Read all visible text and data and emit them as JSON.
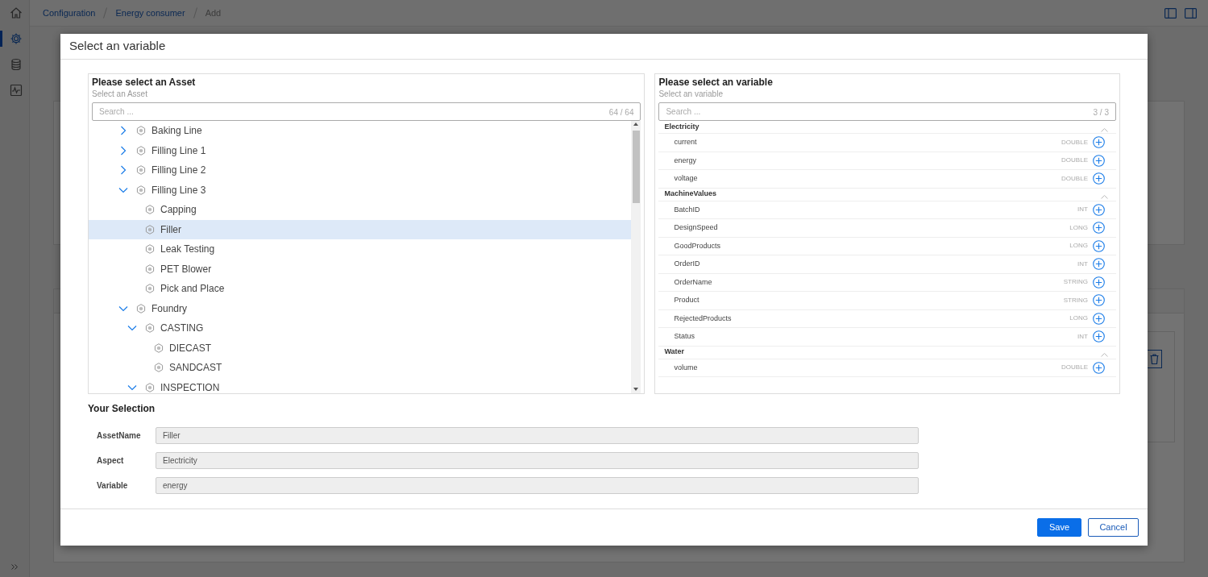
{
  "breadcrumb": [
    {
      "label": "Configuration",
      "current": false
    },
    {
      "label": "Energy consumer",
      "current": false
    },
    {
      "label": "Add",
      "current": true
    }
  ],
  "sidebar": {
    "items": [
      {
        "kind": "settings",
        "selected": true
      },
      {
        "kind": "database",
        "selected": false
      },
      {
        "kind": "monitor",
        "selected": false
      }
    ]
  },
  "dialog": {
    "title": "Select an variable",
    "asset_panel": {
      "title": "Please select an Asset",
      "subtitle": "Select an Asset",
      "search": {
        "placeholder": "Search ...",
        "count": "64 / 64"
      },
      "tree": [
        {
          "label": "Baking Line",
          "expanded": false,
          "selected": false
        },
        {
          "label": "Filling Line 1",
          "expanded": false,
          "selected": false
        },
        {
          "label": "Filling Line 2",
          "expanded": false,
          "selected": false
        },
        {
          "label": "Filling Line 3",
          "expanded": true,
          "selected": false,
          "children": [
            {
              "label": "Capping",
              "selected": false
            },
            {
              "label": "Filler",
              "selected": true
            },
            {
              "label": "Leak Testing",
              "selected": false
            },
            {
              "label": "PET Blower",
              "selected": false
            },
            {
              "label": "Pick and Place",
              "selected": false
            }
          ]
        },
        {
          "label": "Foundry",
          "expanded": true,
          "selected": false,
          "children": [
            {
              "label": "CASTING",
              "expanded": true,
              "selected": false,
              "children": [
                {
                  "label": "DIECAST",
                  "selected": false
                },
                {
                  "label": "SANDCAST",
                  "selected": false
                }
              ]
            },
            {
              "label": "INSPECTION",
              "expanded": true,
              "selected": false
            }
          ]
        }
      ]
    },
    "variable_panel": {
      "title": "Please select an variable",
      "subtitle": "Select an variable",
      "search": {
        "placeholder": "Search ...",
        "count": "3 / 3"
      },
      "groups": [
        {
          "name": "Electricity",
          "expanded": true,
          "variables": [
            {
              "name": "current",
              "type": "DOUBLE"
            },
            {
              "name": "energy",
              "type": "DOUBLE"
            },
            {
              "name": "voltage",
              "type": "DOUBLE"
            }
          ]
        },
        {
          "name": "MachineValues",
          "expanded": true,
          "variables": [
            {
              "name": "BatchID",
              "type": "INT"
            },
            {
              "name": "DesignSpeed",
              "type": "LONG"
            },
            {
              "name": "GoodProducts",
              "type": "LONG"
            },
            {
              "name": "OrderID",
              "type": "INT"
            },
            {
              "name": "OrderName",
              "type": "STRING"
            },
            {
              "name": "Product",
              "type": "STRING"
            },
            {
              "name": "RejectedProducts",
              "type": "LONG"
            },
            {
              "name": "Status",
              "type": "INT"
            }
          ]
        },
        {
          "name": "Water",
          "expanded": true,
          "variables": [
            {
              "name": "volume",
              "type": "DOUBLE"
            }
          ]
        }
      ]
    },
    "selection": {
      "title": "Your Selection",
      "fields": [
        {
          "label": "AssetName",
          "value": "Filler"
        },
        {
          "label": "Aspect",
          "value": "Electricity"
        },
        {
          "label": "Variable",
          "value": "energy"
        }
      ]
    },
    "buttons": [
      {
        "label": "Save",
        "kind": "primary"
      },
      {
        "label": "Cancel",
        "kind": "secondary"
      }
    ]
  }
}
